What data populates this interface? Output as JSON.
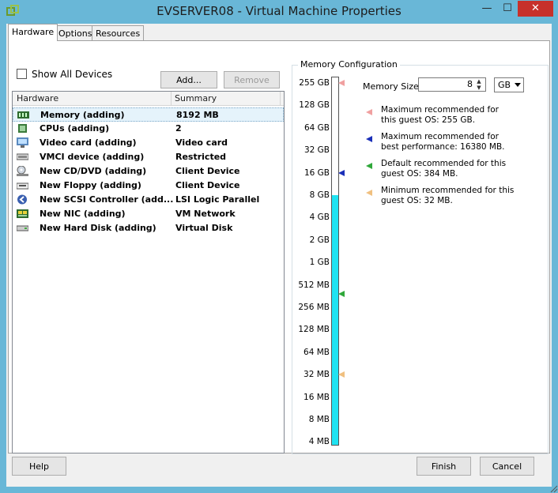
{
  "window": {
    "title": "EVSERVER08 - Virtual Machine Properties",
    "minimize_glyph": "—",
    "maximize_glyph": "☐",
    "close_glyph": "✕"
  },
  "tabs": [
    {
      "label": "Hardware",
      "active": true
    },
    {
      "label": "Options",
      "active": false
    },
    {
      "label": "Resources",
      "active": false
    }
  ],
  "hardware": {
    "show_all_devices_label": "Show All Devices",
    "show_all_devices_checked": false,
    "add_button": "Add...",
    "remove_button": "Remove",
    "columns": [
      "Hardware",
      "Summary"
    ],
    "rows": [
      {
        "name": "Memory (adding)",
        "summary": "8192 MB",
        "icon": "memory-icon",
        "selected": true
      },
      {
        "name": "CPUs (adding)",
        "summary": "2",
        "icon": "cpu-icon",
        "selected": false
      },
      {
        "name": "Video card  (adding)",
        "summary": "Video card",
        "icon": "video-card-icon",
        "selected": false
      },
      {
        "name": "VMCI device (adding)",
        "summary": "Restricted",
        "icon": "vmci-icon",
        "selected": false
      },
      {
        "name": "New CD/DVD (adding)",
        "summary": "Client Device",
        "icon": "cd-dvd-icon",
        "selected": false
      },
      {
        "name": "New Floppy (adding)",
        "summary": "Client Device",
        "icon": "floppy-icon",
        "selected": false
      },
      {
        "name": "New SCSI Controller (add...",
        "summary": "LSI Logic Parallel",
        "icon": "scsi-controller-icon",
        "selected": false
      },
      {
        "name": "New NIC (adding)",
        "summary": "VM Network",
        "icon": "nic-icon",
        "selected": false
      },
      {
        "name": "New Hard Disk (adding)",
        "summary": "Virtual Disk",
        "icon": "hard-disk-icon",
        "selected": false
      }
    ]
  },
  "memory_config": {
    "group_label": "Memory Configuration",
    "memory_size_label": "Memory Size:",
    "memory_size_value": "8",
    "unit_selected": "GB",
    "scale_labels": [
      "255 GB",
      "128 GB",
      "64 GB",
      "32 GB",
      "16 GB",
      "8 GB",
      "4 GB",
      "2 GB",
      "1 GB",
      "512 MB",
      "256 MB",
      "128 MB",
      "64 MB",
      "32 MB",
      "16 MB",
      "8 MB",
      "4 MB"
    ],
    "current_level": "8 GB",
    "legend": [
      {
        "text": "Maximum recommended for this guest OS: 255 GB.",
        "color": "#f0a0a0",
        "at": "255 GB"
      },
      {
        "text": "Maximum recommended for best performance: 16380 MB.",
        "color": "#1a2fb8",
        "at": "16 GB"
      },
      {
        "text": "Default recommended for this guest OS: 384 MB.",
        "color": "#2fa83a",
        "at": "384 MB"
      },
      {
        "text": "Minimum recommended for this guest OS: 32 MB.",
        "color": "#f0c080",
        "at": "32 MB"
      }
    ],
    "bar_color": "#1fe3f2"
  },
  "footer": {
    "help_button": "Help",
    "finish_button": "Finish",
    "cancel_button": "Cancel"
  }
}
